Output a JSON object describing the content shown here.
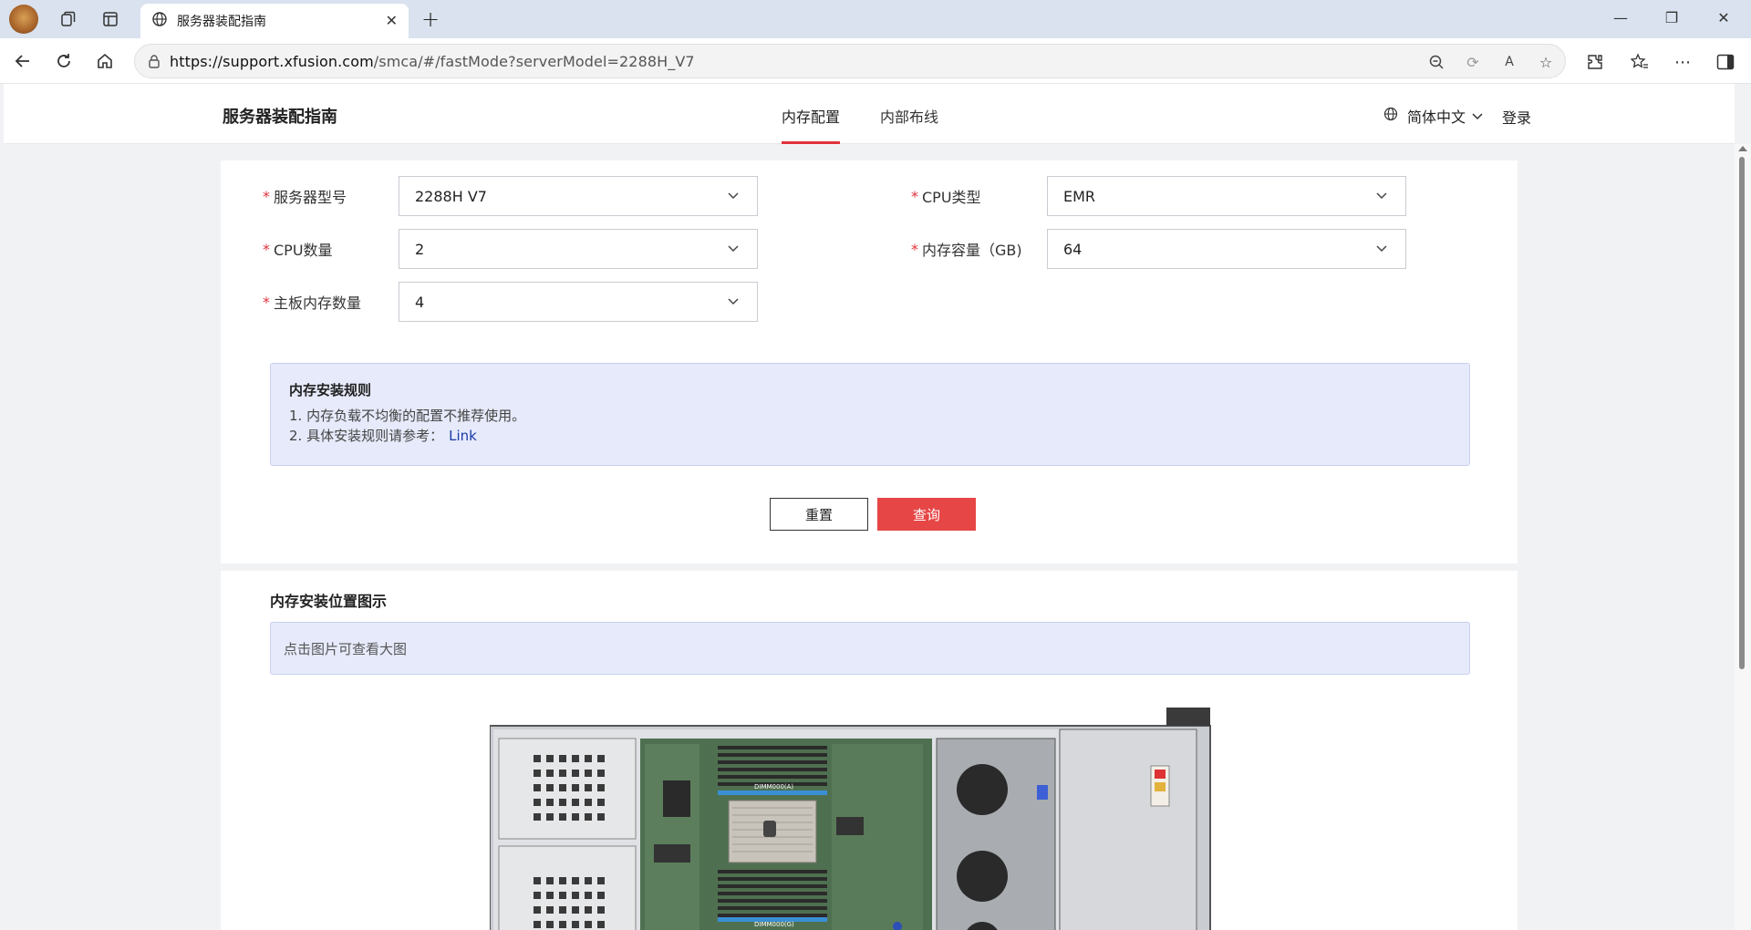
{
  "browser": {
    "tab_title": "服务器装配指南",
    "url_host": "https://support.xfusion.com",
    "url_rest": "/smca/#/fastMode?serverModel=2288H_V7"
  },
  "header": {
    "site_title": "服务器装配指南",
    "nav": [
      {
        "label": "内存配置",
        "active": true
      },
      {
        "label": "内部布线",
        "active": false
      }
    ],
    "language": "简体中文",
    "login": "登录",
    "accent_color": "#e0333b"
  },
  "form": {
    "required_mark": "*",
    "fields": {
      "server_model": {
        "label": "服务器型号",
        "value": "2288H V7"
      },
      "cpu_type": {
        "label": "CPU类型",
        "value": "EMR"
      },
      "cpu_count": {
        "label": "CPU数量",
        "value": "2"
      },
      "memory_capacity": {
        "label": "内存容量（GB)",
        "value": "64"
      },
      "board_memory_count": {
        "label": "主板内存数量",
        "value": "4"
      }
    }
  },
  "rules": {
    "title": "内存安装规则",
    "line1": "1. 内存负载不均衡的配置不推荐使用。",
    "line2": "2. 具体安装规则请参考：",
    "link": "Link"
  },
  "buttons": {
    "reset": "重置",
    "query": "查询"
  },
  "diagram": {
    "title": "内存安装位置图示",
    "hint": "点击图片可查看大图",
    "dimm_label_a": "DIMM000(A)",
    "dimm_label_b": "DIMM000(G)"
  }
}
